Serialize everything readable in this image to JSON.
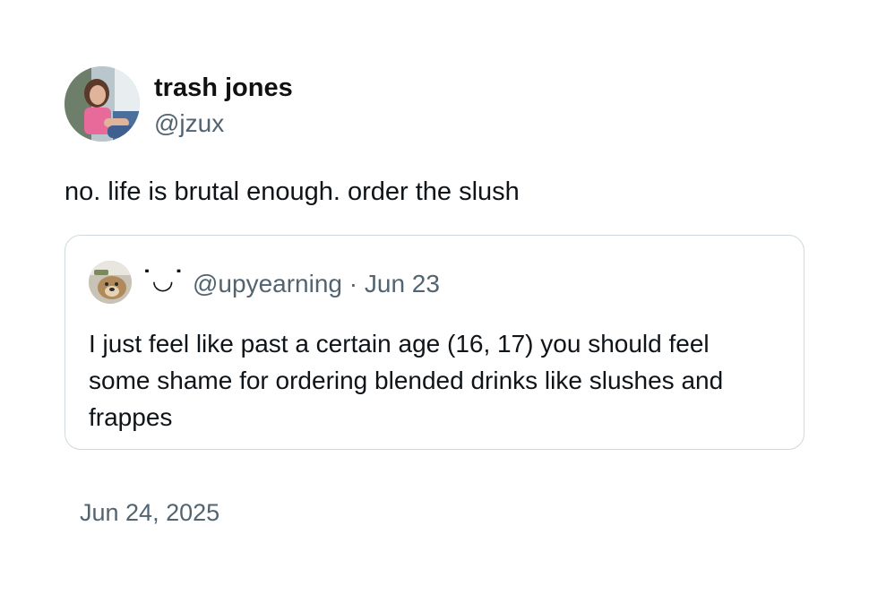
{
  "post": {
    "author": {
      "display_name": "trash jones",
      "handle": "@jzux"
    },
    "text": "no. life is brutal enough. order the slush",
    "quoted_post": {
      "author_name": "˙◡˙",
      "handle": "@upyearning",
      "separator": "·",
      "date": "Jun 23",
      "text": "I just feel like past a certain age (16, 17) you should feel some shame for ordering blended drinks like slushes and frappes"
    },
    "timestamp": "Jun 24, 2025"
  },
  "colors": {
    "primary_text": "#0f1419",
    "secondary_text": "#536471",
    "card_border": "#cfd9de"
  }
}
